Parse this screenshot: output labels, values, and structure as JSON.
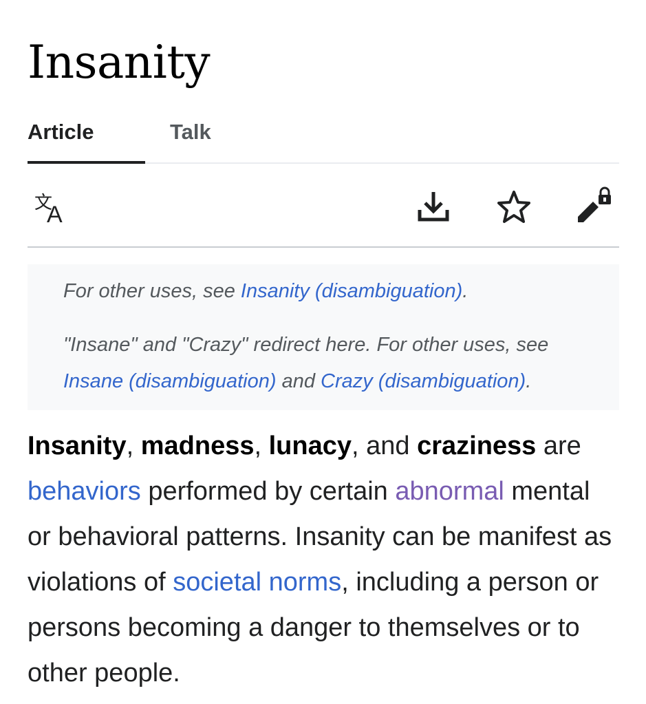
{
  "page": {
    "title": "Insanity"
  },
  "tabs": [
    {
      "label": "Article",
      "active": true
    },
    {
      "label": "Talk",
      "active": false
    }
  ],
  "toolbar": {
    "icons": [
      "language-icon",
      "download-icon",
      "star-icon",
      "edit-locked-icon"
    ]
  },
  "hatnote": {
    "line1_prefix": "For other uses, see ",
    "line1_link": "Insanity (disambiguation)",
    "line1_suffix": ".",
    "line2_prefix": "\"Insane\" and \"Crazy\" redirect here. For other uses, see ",
    "line2_link1": "Insane (disambiguation)",
    "line2_mid": " and ",
    "line2_link2": "Crazy (disambiguation)",
    "line2_suffix": "."
  },
  "intro": {
    "b1": "Insanity",
    "t1": ", ",
    "b2": "madness",
    "t2": ", ",
    "b3": "lunacy",
    "t3": ", and ",
    "b4": "craziness",
    "t4": " are ",
    "link1": "behaviors",
    "t5": " performed by certain ",
    "link2": "abnormal",
    "t6": " mental or behavioral patterns. Insanity can be manifest as violations of ",
    "link3": "societal norms",
    "t7": ", including a person or persons becoming a danger to themselves or to other people."
  },
  "colors": {
    "link": "#3366cc",
    "visited_link": "#795cb2",
    "text": "#202122",
    "hatnote_bg": "#f8f9fa"
  }
}
